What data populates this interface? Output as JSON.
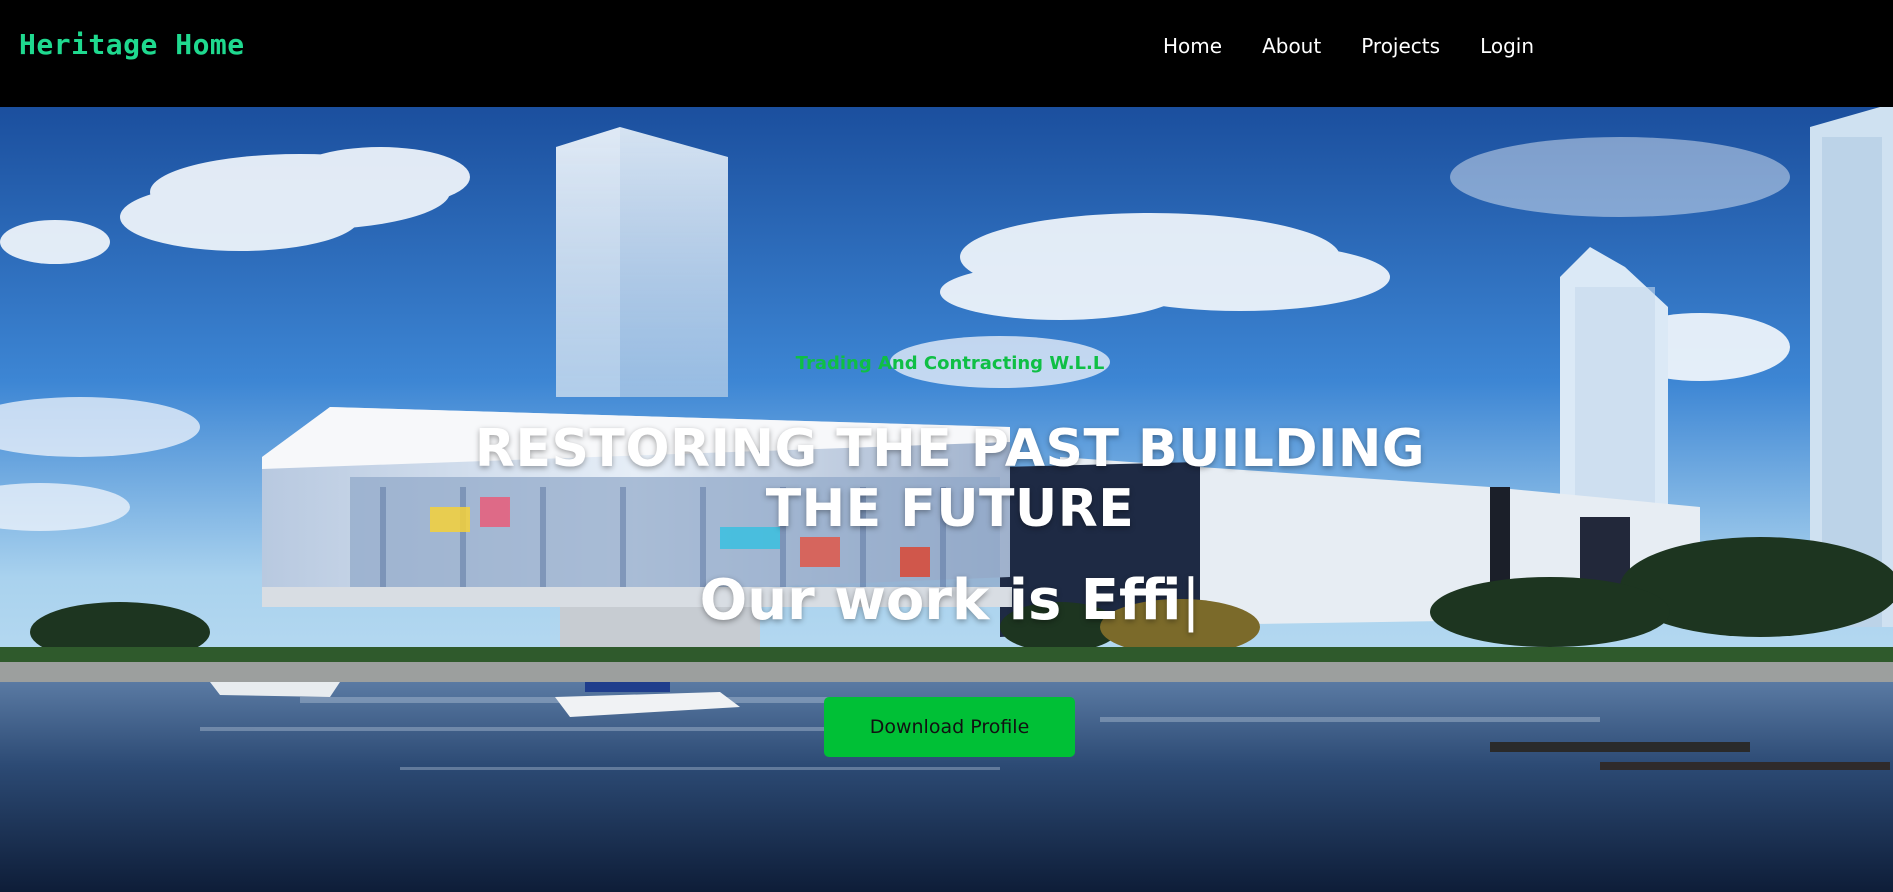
{
  "brand": {
    "name": "Heritage Home"
  },
  "nav": {
    "items": [
      {
        "label": "Home"
      },
      {
        "label": "About"
      },
      {
        "label": "Projects"
      },
      {
        "label": "Login"
      }
    ]
  },
  "hero": {
    "tagline": "Trading And Contracting W.L.L",
    "headline": "RESTORING THE PAST BUILDING THE FUTURE",
    "typed_text": "Our work is Effi",
    "typed_cursor": "|",
    "button_label": "Download Profile"
  },
  "colors": {
    "brand": "#1fd98f",
    "tagline": "#0fbf45",
    "button": "#00c036",
    "navbar_bg": "#000000"
  }
}
